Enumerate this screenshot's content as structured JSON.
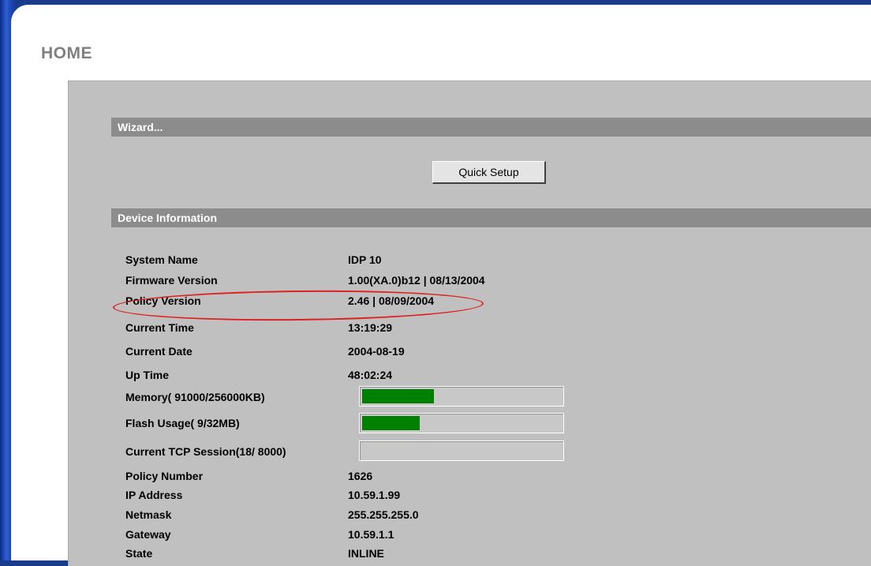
{
  "page": {
    "title": "HOME"
  },
  "wizard": {
    "title": "Wizard...",
    "quick_setup_label": "Quick Setup"
  },
  "device_info": {
    "title": "Device Information",
    "system_name": {
      "label": "System Name",
      "value": "IDP 10"
    },
    "firmware_version": {
      "label": "Firmware Version",
      "value": "1.00(XA.0)b12 | 08/13/2004"
    },
    "policy_version": {
      "label": "Policy Version",
      "value": "2.46 | 08/09/2004"
    },
    "current_time": {
      "label": "Current Time",
      "value": "13:19:29"
    },
    "current_date": {
      "label": "Current Date",
      "value": "2004-08-19"
    },
    "up_time": {
      "label": "Up Time",
      "value": "48:02:24"
    },
    "memory": {
      "label": "Memory( 91000/256000KB)",
      "fraction": 0.36
    },
    "flash_usage": {
      "label": "Flash Usage( 9/32MB)",
      "fraction": 0.29
    },
    "tcp_session": {
      "label": "Current TCP Session(18/ 8000)",
      "fraction": 0.0
    },
    "policy_number": {
      "label": "Policy Number",
      "value": "1626"
    },
    "ip_address": {
      "label": "IP Address",
      "value": "10.59.1.99"
    },
    "netmask": {
      "label": "Netmask",
      "value": "255.255.255.0"
    },
    "gateway": {
      "label": "Gateway",
      "value": "10.59.1.1"
    },
    "state": {
      "label": "State",
      "value": "INLINE"
    }
  },
  "colors": {
    "bar_fill": "#008000",
    "section_bar": "#8c8c8c",
    "highlight": "#dd2222"
  }
}
